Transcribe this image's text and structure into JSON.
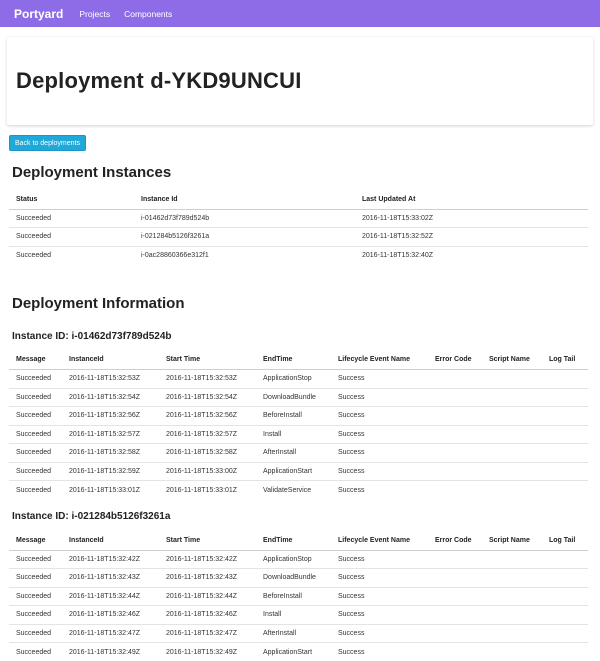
{
  "navbar": {
    "brand": "Portyard",
    "links": [
      "Projects",
      "Components"
    ]
  },
  "page": {
    "title": "Deployment d-YKD9UNCUI",
    "back_button": "Back to deployments"
  },
  "instances_section": {
    "heading": "Deployment Instances",
    "columns": [
      "Status",
      "Instance Id",
      "Last Updated At"
    ],
    "rows": [
      [
        "Succeeded",
        "i-01462d73f789d524b",
        "2016-11-18T15:33:02Z"
      ],
      [
        "Succeeded",
        "i-021284b5126f3261a",
        "2016-11-18T15:32:52Z"
      ],
      [
        "Succeeded",
        "i-0ac28860366e312f1",
        "2016-11-18T15:32:40Z"
      ]
    ]
  },
  "info_section": {
    "heading": "Deployment Information",
    "columns": [
      "Message",
      "InstanceId",
      "Start Time",
      "EndTime",
      "Lifecycle Event Name",
      "Error Code",
      "Script Name",
      "Log Tail"
    ],
    "instances": [
      {
        "title": "Instance ID: i-01462d73f789d524b",
        "rows": [
          [
            "Succeeded",
            "2016-11-18T15:32:53Z",
            "2016-11-18T15:32:53Z",
            "ApplicationStop",
            "Success",
            "",
            "",
            ""
          ],
          [
            "Succeeded",
            "2016-11-18T15:32:54Z",
            "2016-11-18T15:32:54Z",
            "DownloadBundle",
            "Success",
            "",
            "",
            ""
          ],
          [
            "Succeeded",
            "2016-11-18T15:32:56Z",
            "2016-11-18T15:32:56Z",
            "BeforeInstall",
            "Success",
            "",
            "",
            ""
          ],
          [
            "Succeeded",
            "2016-11-18T15:32:57Z",
            "2016-11-18T15:32:57Z",
            "Install",
            "Success",
            "",
            "",
            ""
          ],
          [
            "Succeeded",
            "2016-11-18T15:32:58Z",
            "2016-11-18T15:32:58Z",
            "AfterInstall",
            "Success",
            "",
            "",
            ""
          ],
          [
            "Succeeded",
            "2016-11-18T15:32:59Z",
            "2016-11-18T15:33:00Z",
            "ApplicationStart",
            "Success",
            "",
            "",
            ""
          ],
          [
            "Succeeded",
            "2016-11-18T15:33:01Z",
            "2016-11-18T15:33:01Z",
            "ValidateService",
            "Success",
            "",
            "",
            ""
          ]
        ]
      },
      {
        "title": "Instance ID: i-021284b5126f3261a",
        "rows": [
          [
            "Succeeded",
            "2016-11-18T15:32:42Z",
            "2016-11-18T15:32:42Z",
            "ApplicationStop",
            "Success",
            "",
            "",
            ""
          ],
          [
            "Succeeded",
            "2016-11-18T15:32:43Z",
            "2016-11-18T15:32:43Z",
            "DownloadBundle",
            "Success",
            "",
            "",
            ""
          ],
          [
            "Succeeded",
            "2016-11-18T15:32:44Z",
            "2016-11-18T15:32:44Z",
            "BeforeInstall",
            "Success",
            "",
            "",
            ""
          ],
          [
            "Succeeded",
            "2016-11-18T15:32:46Z",
            "2016-11-18T15:32:46Z",
            "Install",
            "Success",
            "",
            "",
            ""
          ],
          [
            "Succeeded",
            "2016-11-18T15:32:47Z",
            "2016-11-18T15:32:47Z",
            "AfterInstall",
            "Success",
            "",
            "",
            ""
          ],
          [
            "Succeeded",
            "2016-11-18T15:32:49Z",
            "2016-11-18T15:32:49Z",
            "ApplicationStart",
            "Success",
            "",
            "",
            ""
          ]
        ]
      }
    ]
  },
  "colors": {
    "navbar": "#8e6ce8",
    "button": "#20a8d8"
  }
}
